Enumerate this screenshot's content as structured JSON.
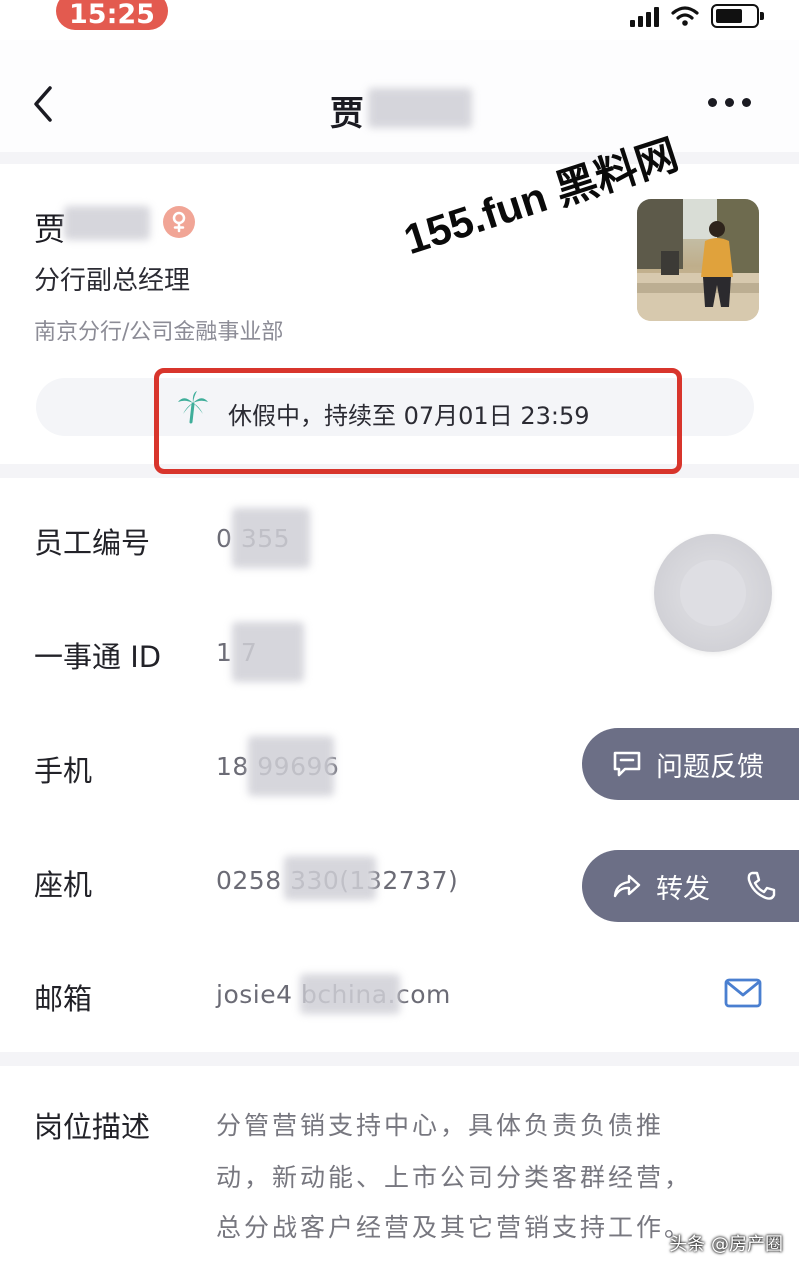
{
  "status_bar": {
    "time": "15:25"
  },
  "nav": {
    "title": "贾"
  },
  "profile": {
    "name": "贾",
    "title": "分行副总经理",
    "department": "南京分行/公司金融事业部",
    "status": "休假中，持续至 07月01日 23:59"
  },
  "watermark": "155.fun 黑料网",
  "info_rows": [
    {
      "label": "员工编号",
      "value": "0        355"
    },
    {
      "label": "一事通 ID",
      "value": "1        7"
    },
    {
      "label": "手机",
      "value": "18          99696"
    },
    {
      "label": "座机",
      "value": "0258          330(132737)"
    },
    {
      "label": "邮箱",
      "value": "josie4            bchina.com"
    }
  ],
  "floating": {
    "feedback_label": "问题反馈",
    "forward_label": "转发"
  },
  "description": {
    "label": "岗位描述",
    "lines": [
      "分管营销支持中心，具体负责负债推",
      "动，新动能、上市公司分类客群经营，",
      "总分战客户经营及其它营销支持工作。"
    ]
  },
  "credit": "头条 @房产圈"
}
